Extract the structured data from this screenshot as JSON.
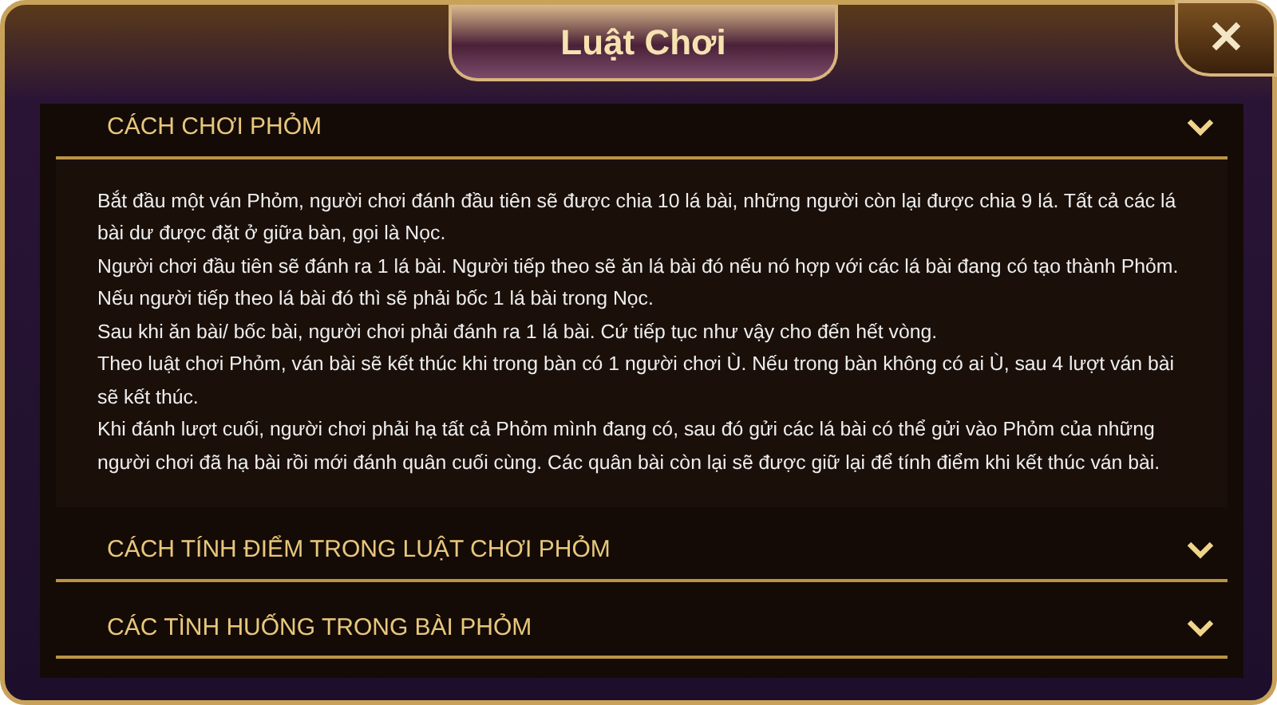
{
  "window": {
    "title": "Luật Chơi",
    "close": "✕"
  },
  "sections": [
    {
      "title": "CÁCH CHƠI PHỎM",
      "expanded": true,
      "paragraphs": [
        "Bắt đầu một ván Phỏm, người chơi đánh đầu tiên sẽ được chia 10 lá bài, những người còn lại được chia 9 lá. Tất cả các lá bài dư được đặt ở giữa bàn, gọi là Nọc.",
        "Người chơi đầu tiên sẽ đánh ra 1 lá bài. Người tiếp theo sẽ ăn lá bài đó nếu nó hợp với các lá bài đang có tạo thành Phỏm.",
        "Nếu người tiếp theo lá bài đó thì sẽ phải bốc 1 lá bài trong Nọc.",
        "Sau khi ăn bài/ bốc bài, người chơi phải đánh ra 1 lá bài. Cứ tiếp tục như vậy cho đến hết vòng.",
        "Theo luật chơi Phỏm, ván bài sẽ kết thúc khi trong bàn có 1 người chơi Ù. Nếu trong bàn không có ai Ù, sau 4 lượt ván bài sẽ kết thúc.",
        "Khi đánh lượt cuối, người chơi phải hạ tất cả Phỏm mình đang có, sau đó gửi các lá bài có thể gửi vào Phỏm của những người chơi đã hạ bài rồi mới đánh quân cuối cùng. Các quân bài còn lại sẽ được giữ lại để tính điểm khi kết thúc ván bài."
      ]
    },
    {
      "title": "CÁCH TÍNH ĐIỂM TRONG LUẬT CHƠI PHỎM",
      "expanded": false
    },
    {
      "title": "CÁC TÌNH HUỐNG TRONG BÀI PHỎM",
      "expanded": false
    }
  ]
}
